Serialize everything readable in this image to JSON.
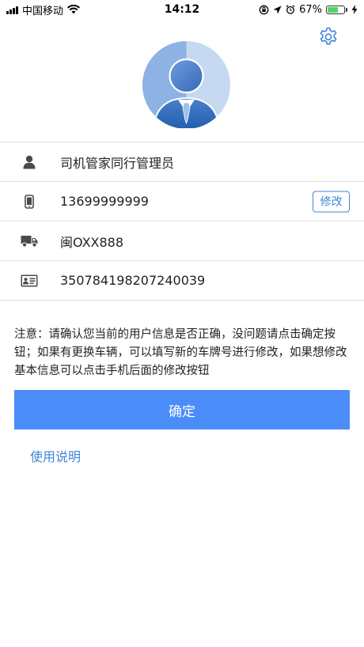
{
  "status_bar": {
    "carrier": "中国移动",
    "time": "14:12",
    "battery_percent": "67%",
    "battery_level": 0.67
  },
  "profile": {
    "name": "司机管家同行管理员",
    "phone": "13699999999",
    "edit_label": "修改",
    "plate": "闽OXX888",
    "id_number": "350784198207240039"
  },
  "notice": {
    "text": "注意：请确认您当前的用户信息是否正确，没问题请点击确定按钮；如果有更换车辆，可以填写新的车牌号进行修改，如果想修改基本信息可以点击手机后面的修改按钮"
  },
  "actions": {
    "confirm_label": "确定",
    "usage_label": "使用说明"
  },
  "colors": {
    "accent": "#4a8df8",
    "link": "#3f86d8",
    "battery": "#4cd964",
    "divider": "#e1e1e1"
  },
  "icons": {
    "settings": "gear-icon",
    "name": "person-icon",
    "phone": "phone-icon",
    "plate": "truck-icon",
    "id": "id-card-icon"
  }
}
